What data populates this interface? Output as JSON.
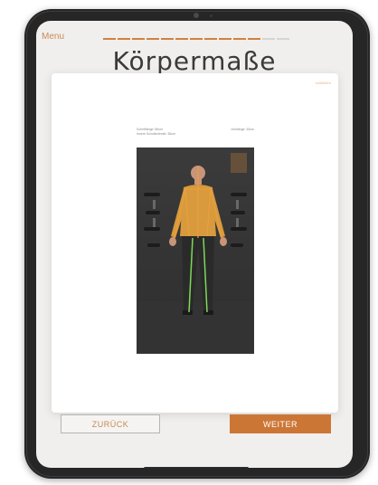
{
  "app": {
    "menu_label": "Menu",
    "page_title": "Körpermaße",
    "progress": {
      "total_steps": 13,
      "completed_steps": 11
    }
  },
  "modal": {
    "close_label": "schließen",
    "measurements": {
      "row1_left": "Schrittlänge: 86cm",
      "row1_right": "Armlänge: 63cm",
      "row2_left": "Innere Schulterbreite: 38cm"
    }
  },
  "footer": {
    "back_label": "ZURÜCK",
    "next_label": "WEITER"
  },
  "colors": {
    "accent": "#cc7636",
    "skeleton_orange": "#e8a040",
    "skeleton_green": "#7ed957"
  }
}
